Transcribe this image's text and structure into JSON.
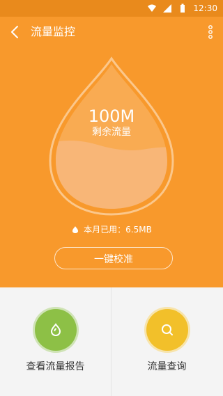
{
  "status": {
    "time": "12:30"
  },
  "header": {
    "title": "流量监控"
  },
  "hero": {
    "remaining_value": "100M",
    "remaining_label": "剩余流量",
    "used_label": "本月已用：6.5MB",
    "calibrate_label": "一键校准"
  },
  "actions": [
    {
      "label": "查看流量报告",
      "color": "#8dc046",
      "icon": "drop-icon"
    },
    {
      "label": "流量查询",
      "color": "#f2c02a",
      "icon": "search-icon"
    }
  ],
  "colors": {
    "primary": "#f8992c",
    "statusbar": "#e98a1c"
  }
}
